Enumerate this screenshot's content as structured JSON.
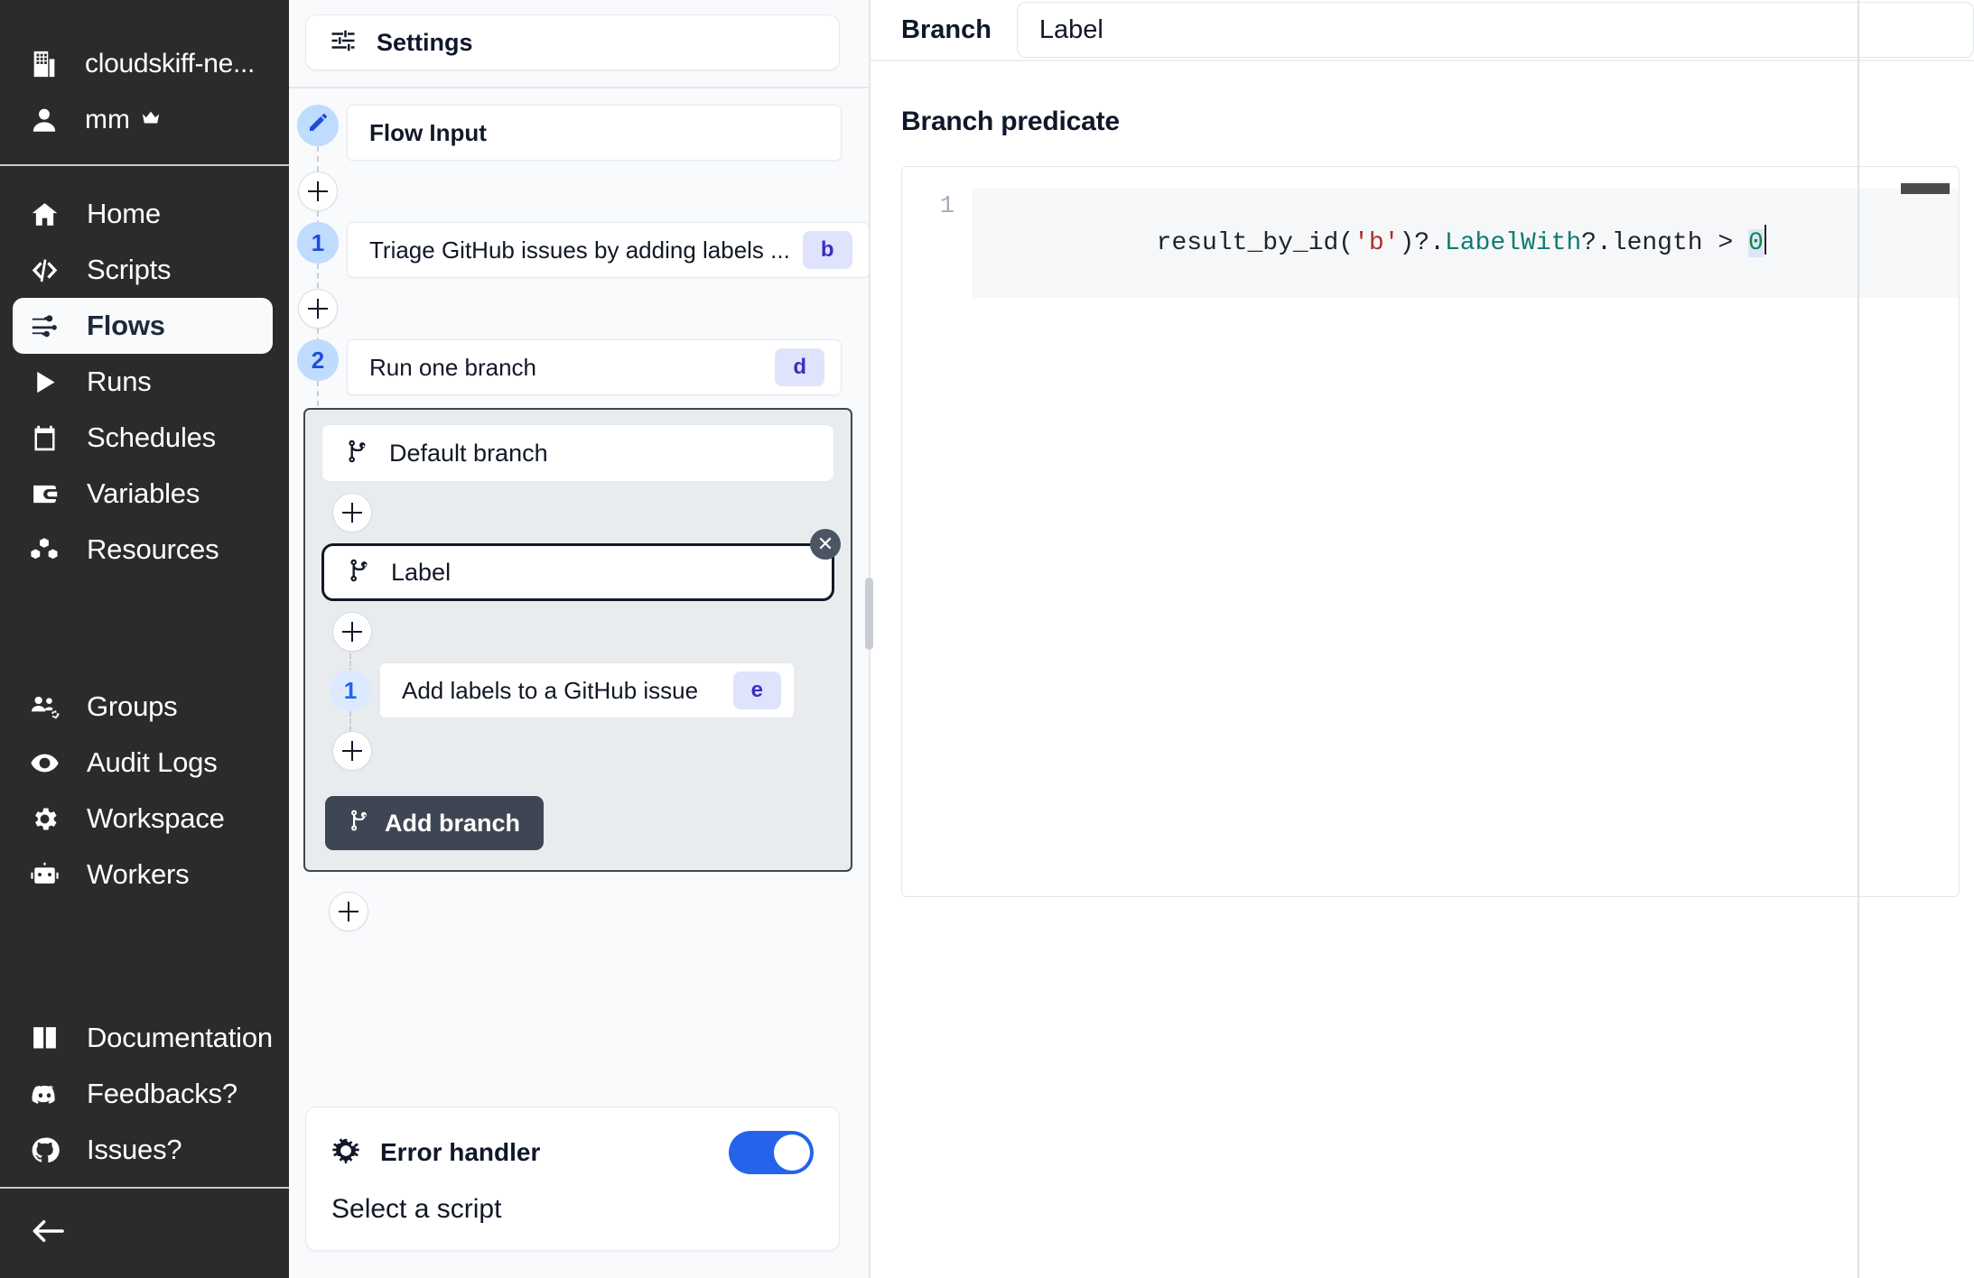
{
  "sidebar": {
    "workspace": {
      "name": "cloudskiff-ne...",
      "icon": "building-icon"
    },
    "user": {
      "name": "mm",
      "icon": "user-icon",
      "badge_icon": "crown-icon"
    },
    "nav": [
      {
        "label": "Home",
        "icon": "home-icon",
        "active": false
      },
      {
        "label": "Scripts",
        "icon": "code-icon",
        "active": false
      },
      {
        "label": "Flows",
        "icon": "wind-icon",
        "active": true
      },
      {
        "label": "Runs",
        "icon": "play-icon",
        "active": false
      },
      {
        "label": "Schedules",
        "icon": "calendar-icon",
        "active": false
      },
      {
        "label": "Variables",
        "icon": "wallet-icon",
        "active": false
      },
      {
        "label": "Resources",
        "icon": "boxes-icon",
        "active": false
      }
    ],
    "nav_admin": [
      {
        "label": "Groups",
        "icon": "users-gear-icon"
      },
      {
        "label": "Audit Logs",
        "icon": "eye-icon"
      },
      {
        "label": "Workspace",
        "icon": "gear-icon"
      },
      {
        "label": "Workers",
        "icon": "robot-icon"
      }
    ],
    "nav_footer": [
      {
        "label": "Documentation",
        "icon": "book-icon"
      },
      {
        "label": "Feedbacks?",
        "icon": "discord-icon"
      },
      {
        "label": "Issues?",
        "icon": "github-icon"
      }
    ],
    "collapse_icon": "arrow-left-icon"
  },
  "flow": {
    "settings": {
      "label": "Settings",
      "icon": "sliders-icon"
    },
    "input_node": {
      "label": "Flow Input",
      "icon": "pencil-icon"
    },
    "steps": [
      {
        "number": "1",
        "label": "Triage GitHub issues by adding labels ...",
        "badge": "b"
      },
      {
        "number": "2",
        "label": "Run one branch",
        "badge": "d"
      }
    ],
    "branches": {
      "default_branch": {
        "label": "Default branch",
        "icon": "git-branch-icon"
      },
      "selected_branch": {
        "label": "Label",
        "icon": "git-branch-icon",
        "close_icon": "close-icon"
      },
      "inner_step": {
        "number": "1",
        "label": "Add labels to a GitHub issue",
        "badge": "e"
      },
      "add_branch_button": {
        "label": "Add branch",
        "icon": "git-branch-icon"
      }
    },
    "add_step_icon": "plus-icon",
    "error_handler": {
      "title": "Error handler",
      "icon": "bug-icon",
      "toggle_on": true,
      "subtitle": "Select a script"
    }
  },
  "right_panel": {
    "branch_label": "Branch",
    "branch_name_value": "Label",
    "branch_name_placeholder": "Label",
    "predicate_title": "Branch predicate",
    "code": {
      "line_number": "1",
      "tokens": [
        {
          "text": "result_by_id(",
          "type": "plain"
        },
        {
          "text": "'b'",
          "type": "string"
        },
        {
          "text": ")?.",
          "type": "plain"
        },
        {
          "text": "LabelWith",
          "type": "property"
        },
        {
          "text": "?.length > ",
          "type": "plain"
        },
        {
          "text": "0",
          "type": "number"
        }
      ],
      "full_text": "result_by_id('b')?.LabelWith?.length > 0"
    }
  },
  "colors": {
    "sidebar_bg": "#2b2b2b",
    "accent_blue": "#2563eb",
    "badge_bg": "#e0e3fc",
    "badge_text": "#3730c4",
    "branch_border": "#3f4653",
    "canvas_bg": "#f8fafc",
    "branch_box_bg": "#e9ecef"
  }
}
